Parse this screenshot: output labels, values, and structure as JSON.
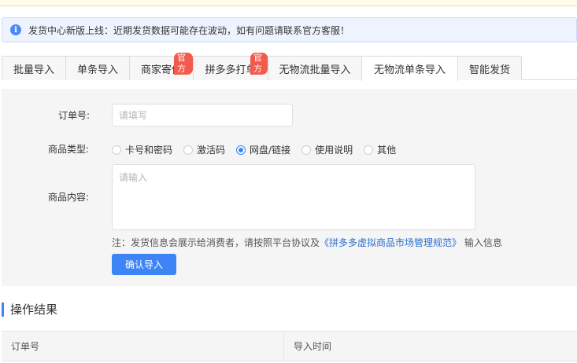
{
  "notice": {
    "icon": "info-icon",
    "text": "发货中心新版上线：近期发货数据可能存在波动，如有问题请联系官方客服！"
  },
  "tabs": [
    {
      "label": "批量导入",
      "badge": "",
      "active": false
    },
    {
      "label": "单条导入",
      "badge": "",
      "active": false
    },
    {
      "label": "商家寄件",
      "badge": "官方",
      "active": false
    },
    {
      "label": "拼多多打单",
      "badge": "官方",
      "active": false
    },
    {
      "label": "无物流批量导入",
      "badge": "",
      "active": false
    },
    {
      "label": "无物流单条导入",
      "badge": "",
      "active": true
    },
    {
      "label": "智能发货",
      "badge": "",
      "active": false
    }
  ],
  "form": {
    "order_label": "订单号:",
    "order_placeholder": "请填写",
    "type_label": "商品类型:",
    "type_options": [
      {
        "label": "卡号和密码",
        "checked": false
      },
      {
        "label": "激活码",
        "checked": false
      },
      {
        "label": "网盘/链接",
        "checked": true
      },
      {
        "label": "使用说明",
        "checked": false
      },
      {
        "label": "其他",
        "checked": false
      }
    ],
    "content_label": "商品内容:",
    "content_placeholder": "请输入",
    "note_prefix": "注：发货信息会展示给消费者，请按照平台协议及",
    "note_link": "《拼多多虚拟商品市场管理规范》",
    "note_suffix": "输入信息",
    "confirm_label": "确认导入"
  },
  "result": {
    "title": "操作结果",
    "columns": [
      "订单号",
      "导入时间"
    ]
  },
  "colors": {
    "accent": "#3d84f7",
    "badge": "#f25a4c",
    "notice_bg": "#eef4ff",
    "panel_bg": "#f5f5f5"
  }
}
